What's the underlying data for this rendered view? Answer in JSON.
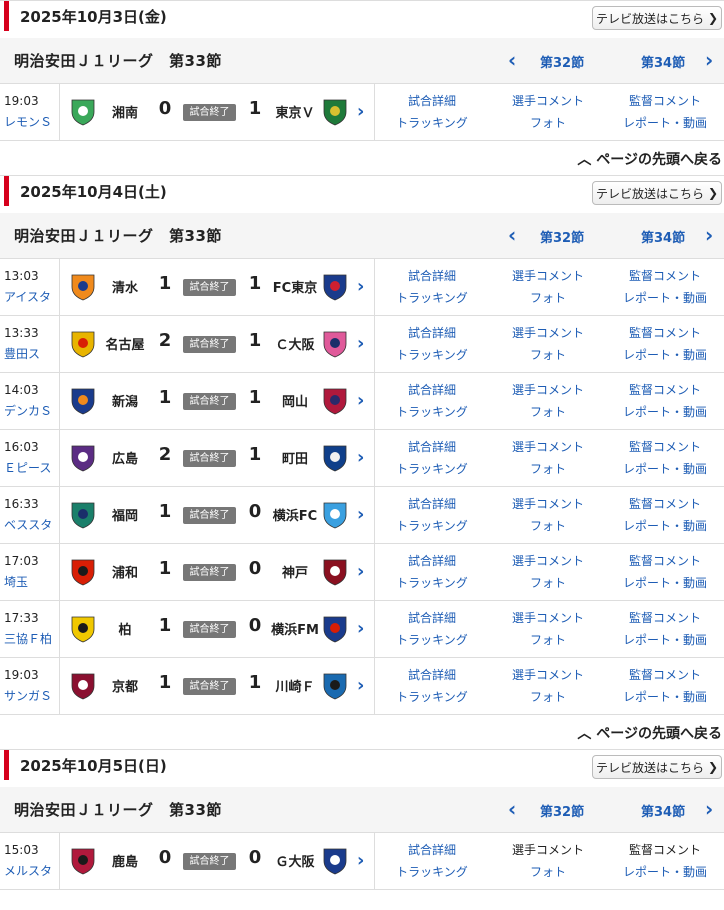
{
  "icons": {
    "left": "chevron-left-icon",
    "right": "chevron-right-icon",
    "up": "chevron-up-icon"
  },
  "colors": {
    "accent": "#d6001c",
    "link": "#1e5db5",
    "status_bg": "#777777"
  },
  "status_label": "試合終了",
  "back_to_top": "ページの先頭へ戻る",
  "sections": [
    {
      "date": "2025年10月3日(金)",
      "tv_label": "テレビ放送はこちら",
      "league": "明治安田Ｊ１リーグ　第33節",
      "prev": "第32節",
      "next": "第34節",
      "matches": [
        {
          "time": "19:03",
          "venue": "レモンＳ",
          "home": "湘南",
          "home_score": "0",
          "away_score": "1",
          "away": "東京Ｖ",
          "home_colors": [
            "#3aa85a",
            "#ffffff"
          ],
          "away_colors": [
            "#1f7a3a",
            "#d8c030"
          ],
          "links": [
            "試合詳細",
            "選手コメント",
            "監督コメント",
            "トラッキング",
            "フォト",
            "レポート・動画"
          ],
          "off": [
            false,
            false,
            false,
            false,
            false,
            false
          ]
        }
      ]
    },
    {
      "date": "2025年10月4日(土)",
      "tv_label": "テレビ放送はこちら",
      "league": "明治安田Ｊ１リーグ　第33節",
      "prev": "第32節",
      "next": "第34節",
      "matches": [
        {
          "time": "13:03",
          "venue": "アイスタ",
          "home": "清水",
          "home_score": "1",
          "away_score": "1",
          "away": "FC東京",
          "home_colors": [
            "#f08a1c",
            "#1a3b8c"
          ],
          "away_colors": [
            "#1a3b8c",
            "#d02030"
          ],
          "links": [
            "試合詳細",
            "選手コメント",
            "監督コメント",
            "トラッキング",
            "フォト",
            "レポート・動画"
          ],
          "off": [
            false,
            false,
            false,
            false,
            false,
            false
          ]
        },
        {
          "time": "13:33",
          "venue": "豊田ス",
          "home": "名古屋",
          "home_score": "2",
          "away_score": "1",
          "away": "Ｃ大阪",
          "home_colors": [
            "#e8b400",
            "#d81e05"
          ],
          "away_colors": [
            "#e05a9a",
            "#1a2e6a"
          ],
          "links": [
            "試合詳細",
            "選手コメント",
            "監督コメント",
            "トラッキング",
            "フォト",
            "レポート・動画"
          ],
          "off": [
            false,
            false,
            false,
            false,
            false,
            false
          ]
        },
        {
          "time": "14:03",
          "venue": "デンカＳ",
          "home": "新潟",
          "home_score": "1",
          "away_score": "1",
          "away": "岡山",
          "home_colors": [
            "#1a3b8c",
            "#f08a1c"
          ],
          "away_colors": [
            "#b0193c",
            "#2a2a6a"
          ],
          "links": [
            "試合詳細",
            "選手コメント",
            "監督コメント",
            "トラッキング",
            "フォト",
            "レポート・動画"
          ],
          "off": [
            false,
            false,
            false,
            false,
            false,
            false
          ]
        },
        {
          "time": "16:03",
          "venue": "Ｅピース",
          "home": "広島",
          "home_score": "2",
          "away_score": "1",
          "away": "町田",
          "home_colors": [
            "#5b2c83",
            "#ffffff"
          ],
          "away_colors": [
            "#0f3f8a",
            "#f0f0f0"
          ],
          "links": [
            "試合詳細",
            "選手コメント",
            "監督コメント",
            "トラッキング",
            "フォト",
            "レポート・動画"
          ],
          "off": [
            false,
            false,
            false,
            false,
            false,
            false
          ]
        },
        {
          "time": "16:33",
          "venue": "ベススタ",
          "home": "福岡",
          "home_score": "1",
          "away_score": "0",
          "away": "横浜FC",
          "home_colors": [
            "#1a7f6a",
            "#1a2e6a"
          ],
          "away_colors": [
            "#3aa0e0",
            "#ffffff"
          ],
          "links": [
            "試合詳細",
            "選手コメント",
            "監督コメント",
            "トラッキング",
            "フォト",
            "レポート・動画"
          ],
          "off": [
            false,
            false,
            false,
            false,
            false,
            false
          ]
        },
        {
          "time": "17:03",
          "venue": "埼玉",
          "home": "浦和",
          "home_score": "1",
          "away_score": "0",
          "away": "神戸",
          "home_colors": [
            "#d81e05",
            "#1a1a1a"
          ],
          "away_colors": [
            "#8a1020",
            "#ffffff"
          ],
          "links": [
            "試合詳細",
            "選手コメント",
            "監督コメント",
            "トラッキング",
            "フォト",
            "レポート・動画"
          ],
          "off": [
            false,
            false,
            false,
            false,
            false,
            false
          ]
        },
        {
          "time": "17:33",
          "venue": "三協Ｆ柏",
          "home": "柏",
          "home_score": "1",
          "away_score": "0",
          "away": "横浜FM",
          "home_colors": [
            "#f0c800",
            "#1a1a1a"
          ],
          "away_colors": [
            "#1a3b8c",
            "#d81e05"
          ],
          "links": [
            "試合詳細",
            "選手コメント",
            "監督コメント",
            "トラッキング",
            "フォト",
            "レポート・動画"
          ],
          "off": [
            false,
            false,
            false,
            false,
            false,
            false
          ]
        },
        {
          "time": "19:03",
          "venue": "サンガＳ",
          "home": "京都",
          "home_score": "1",
          "away_score": "1",
          "away": "川崎Ｆ",
          "home_colors": [
            "#8a1030",
            "#ffffff"
          ],
          "away_colors": [
            "#1a6ab0",
            "#1a1a1a"
          ],
          "links": [
            "試合詳細",
            "選手コメント",
            "監督コメント",
            "トラッキング",
            "フォト",
            "レポート・動画"
          ],
          "off": [
            false,
            false,
            false,
            false,
            false,
            false
          ]
        }
      ]
    },
    {
      "date": "2025年10月5日(日)",
      "tv_label": "テレビ放送はこちら",
      "league": "明治安田Ｊ１リーグ　第33節",
      "prev": "第32節",
      "next": "第34節",
      "matches": [
        {
          "time": "15:03",
          "venue": "メルスタ",
          "home": "鹿島",
          "home_score": "0",
          "away_score": "0",
          "away": "Ｇ大阪",
          "home_colors": [
            "#b0193c",
            "#1a1a1a"
          ],
          "away_colors": [
            "#1a3b8c",
            "#ffffff"
          ],
          "links": [
            "試合詳細",
            "選手コメント",
            "監督コメント",
            "トラッキング",
            "フォト",
            "レポート・動画"
          ],
          "off": [
            false,
            true,
            true,
            false,
            false,
            false
          ]
        }
      ]
    }
  ]
}
